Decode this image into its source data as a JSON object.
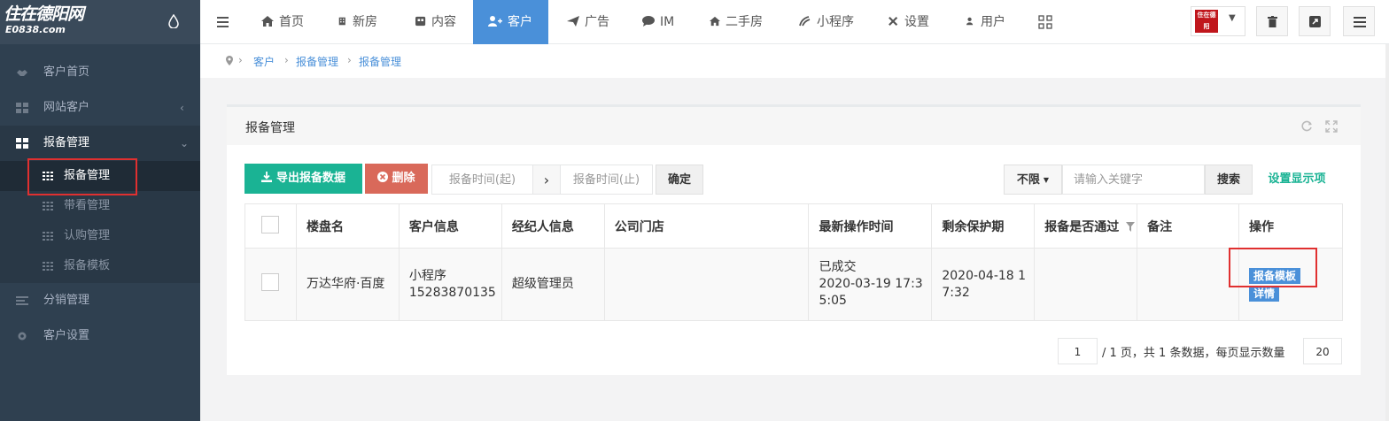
{
  "logo": {
    "title": "住在德阳网",
    "subtitle": "E0838.com"
  },
  "sidebar": {
    "items": [
      {
        "label": "客户首页",
        "icon": "handshake-icon"
      },
      {
        "label": "网站客户",
        "icon": "grid-icon"
      },
      {
        "label": "报备管理",
        "icon": "grid-icon",
        "active": true
      },
      {
        "label": "分销管理",
        "icon": "list-icon"
      },
      {
        "label": "客户设置",
        "icon": "gear-icon"
      }
    ],
    "sub_items": [
      {
        "label": "报备管理"
      },
      {
        "label": "带看管理"
      },
      {
        "label": "认购管理"
      },
      {
        "label": "报备模板"
      }
    ]
  },
  "topnav": {
    "menu_icon": "hamburger-icon",
    "items": [
      {
        "label": "首页",
        "icon": "home-icon"
      },
      {
        "label": "新房",
        "icon": "building-icon"
      },
      {
        "label": "内容",
        "icon": "content-icon"
      },
      {
        "label": "客户",
        "icon": "user-plus-icon",
        "active": true
      },
      {
        "label": "广告",
        "icon": "send-icon"
      },
      {
        "label": "IM",
        "icon": "chat-icon"
      },
      {
        "label": "二手房",
        "icon": "home-icon"
      },
      {
        "label": "小程序",
        "icon": "miniapp-icon"
      },
      {
        "label": "设置",
        "icon": "tools-icon"
      },
      {
        "label": "用户",
        "icon": "user-icon"
      }
    ],
    "right_badge": "住在德阳"
  },
  "breadcrumb": [
    "客户",
    "报备管理",
    "报备管理"
  ],
  "panel": {
    "title": "报备管理"
  },
  "toolbar": {
    "export_label": "导出报备数据",
    "delete_label": "删除",
    "date_start_placeholder": "报备时间(起)",
    "date_end_placeholder": "报备时间(止)",
    "confirm_label": "确定",
    "filter_value": "不限",
    "search_placeholder": "请输入关键字",
    "search_label": "搜索",
    "display_settings_label": "设置显示项"
  },
  "table": {
    "headers": [
      "楼盘名",
      "客户信息",
      "经纪人信息",
      "公司门店",
      "最新操作时间",
      "剩余保护期",
      "报备是否通过",
      "备注",
      "操作"
    ],
    "rows": [
      {
        "property": "万达华府·百度",
        "client_source": "小程序",
        "client_phone": "15283870135",
        "agent": "超级管理员",
        "store": "",
        "status": "已成交",
        "operation_time": "2020-03-19 17:3",
        "operation_time_2": "5:05",
        "protection": "2020-04-18 1",
        "protection_2": "7:32",
        "passed": "",
        "remark": "",
        "actions": [
          "报备模板",
          "详情"
        ]
      }
    ]
  },
  "pagination": {
    "current_page": "1",
    "total_pages_text": "/ 1 页，共 1 条数据，每页显示数量",
    "per_page": "20"
  }
}
